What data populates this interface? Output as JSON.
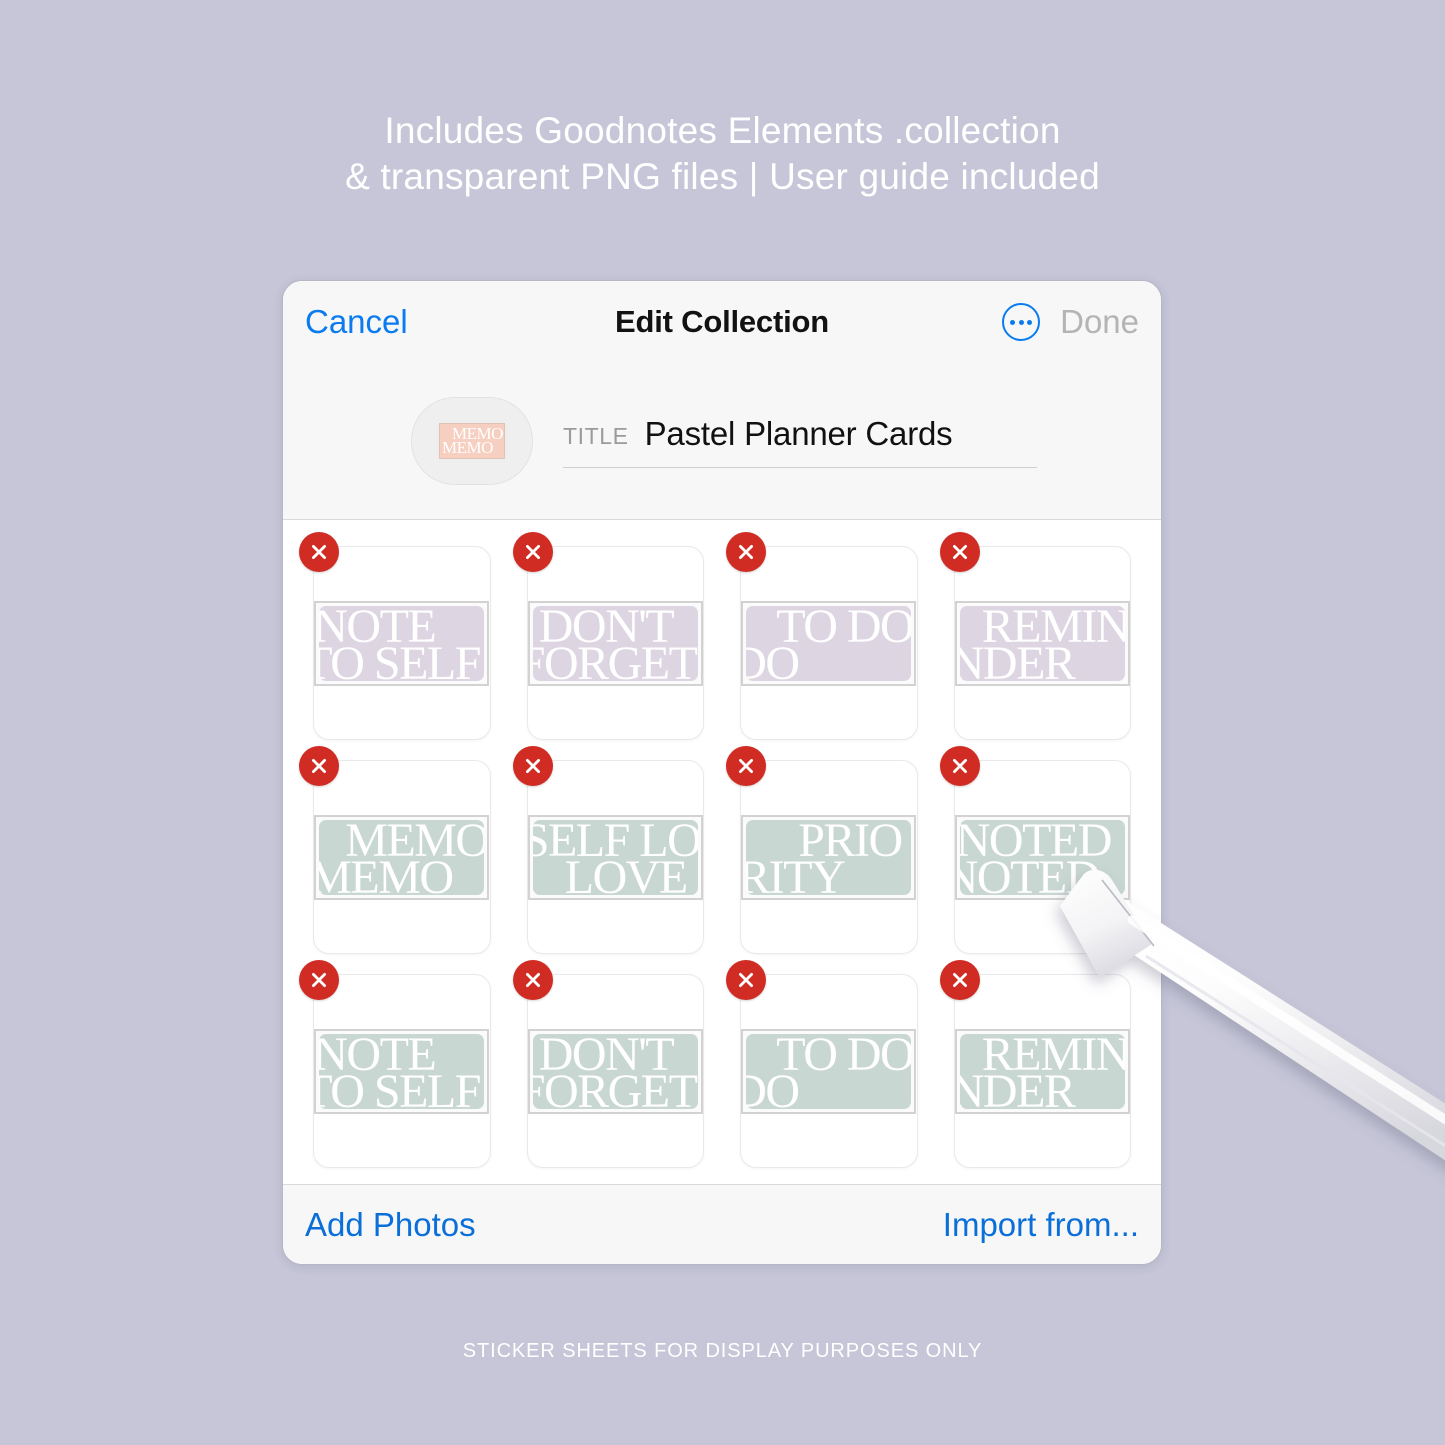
{
  "promo": {
    "line1": "Includes Goodnotes Elements .collection",
    "line2": "& transparent PNG files | User guide included"
  },
  "footer": {
    "note": "STICKER SHEETS FOR DISPLAY PURPOSES ONLY"
  },
  "dialog": {
    "navbar": {
      "cancel_label": "Cancel",
      "title": "Edit Collection",
      "more_icon": "ellipsis-circle-icon",
      "done_label": "Done"
    },
    "title_section": {
      "label": "TITLE",
      "value": "Pastel Planner Cards",
      "thumbnail": {
        "line1": "MEMO",
        "line2": "MEMO",
        "color": "#f7cfc0"
      }
    },
    "bottombar": {
      "add_photos_label": "Add Photos",
      "import_from_label": "Import from..."
    }
  },
  "colors": {
    "page_background": "#c6c6d8",
    "accent_blue": "#0a7cf0",
    "link_blue": "#0a6fd8",
    "delete_red": "#d02c23",
    "sticker_lavender": "#ddd6e2",
    "sticker_sage": "#c9d7d2",
    "thumbnail_peach": "#f7cfc0",
    "done_disabled": "#b4b4b4"
  },
  "stickers": [
    {
      "line1": "NOTE",
      "line2": "TO SELF",
      "color": "lav",
      "offset": "off-a",
      "delete_icon": "close-circle-icon"
    },
    {
      "line1": "DON'T",
      "line2": "FORGET",
      "color": "lav",
      "offset": "off-b",
      "delete_icon": "close-circle-icon"
    },
    {
      "line1": "TO DO",
      "line2": "DO",
      "color": "lav",
      "offset": "off-c",
      "delete_icon": "close-circle-icon"
    },
    {
      "line1": "REMIN",
      "line2": "NDER",
      "color": "lav",
      "offset": "off-d",
      "delete_icon": "close-circle-icon"
    },
    {
      "line1": "MEMO",
      "line2": "MEMO",
      "color": "sage",
      "offset": "off-e",
      "delete_icon": "close-circle-icon"
    },
    {
      "line1": "SELF LO",
      "line2": "LOVE",
      "color": "sage",
      "offset": "off-f",
      "delete_icon": "close-circle-icon"
    },
    {
      "line1": "PRIO",
      "line2": "RITY",
      "color": "sage",
      "offset": "off-g",
      "delete_icon": "close-circle-icon"
    },
    {
      "line1": "NOTED",
      "line2": "NOTED",
      "color": "sage",
      "offset": "off-h",
      "delete_icon": "close-circle-icon"
    },
    {
      "line1": "NOTE",
      "line2": "TO SELF",
      "color": "sage",
      "offset": "off-a",
      "delete_icon": "close-circle-icon"
    },
    {
      "line1": "DON'T",
      "line2": "FORGET",
      "color": "sage",
      "offset": "off-b",
      "delete_icon": "close-circle-icon"
    },
    {
      "line1": "TO DO",
      "line2": "DO",
      "color": "sage",
      "offset": "off-c",
      "delete_icon": "close-circle-icon"
    },
    {
      "line1": "REMIN",
      "line2": "NDER",
      "color": "sage",
      "offset": "off-d",
      "delete_icon": "close-circle-icon"
    }
  ],
  "pencil": {
    "name": "apple-pencil"
  }
}
